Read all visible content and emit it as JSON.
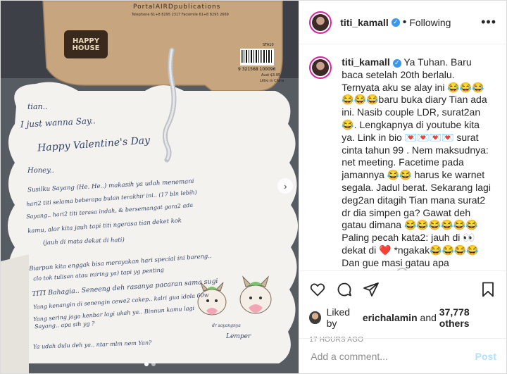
{
  "colors": {
    "accent": "#3897f0",
    "story_ring": "#d6249f",
    "heart": "#ed4956"
  },
  "photo": {
    "publisher": "PortalAIRDpublications",
    "publisher_contact": "Telephone 61+8 8295 2317 Facsimile 61+8 8295 2669",
    "logo": "HAPPY HOUSE",
    "barcode": "9 321568 100096",
    "sku": "STA10",
    "price": "Aust $3.95",
    "origin": "Litho in China",
    "letter_lines": [
      "tian..",
      "I just wanna Say..",
      "Happy Valentine's Day",
      "Honey..",
      "Susilku Sayang (He. He..) makasih ya udah menemani",
      "hari2 titi selama beberapa bulan terakhir ini.. (17 bln lebih)",
      "Sayang.. hari2 titi terasa indah, & bersemangat gara2 ada",
      "kamu, alor kita jauh tapi titi ngerasa tian deket kok",
      "(jauh di mata dekat di hati)",
      "Biarpun kita enggak bisa merayakan hari special ini bareng..",
      "clo tok tulisan atau miring ya) tapi yg penting",
      "TITI Bahagia.. Seneeng deh rasanya pacaran sama sugi",
      "Yang kenangin di senengin cewe2 cakep.. kalri gua idola 60w",
      "Yang sering jaga kenbar lagi ukah ya.. Binnun kamu lagi",
      "Sayang.. apa sih yg ?",
      "Ya udah dulu deh ya.. ntar mlm nem Yan?",
      "Lemper"
    ],
    "sticker_text": "dr sayangnya",
    "page_count": 2,
    "active_page": 1
  },
  "header": {
    "username": "titi_kamall",
    "verified": true,
    "separator": "•",
    "follow_label": "Following",
    "more": "•••"
  },
  "caption": {
    "username": "titi_kamall",
    "text": "Ya Tuhan. Baru baca setelah 20th berlalu. Ternyata aku se alay ini 😂😂😂😂😂😂baru buka diary Tian ada ini. Nasib couple LDR, surat2an😂. Lengkapnya di youtube kita ya. Link in bio 💌💌💌💌 surat cinta tahun 99 . Nem maksudnya: net meeting. Facetime pada jamannya 😂😂 harus ke warnet segala. Jadul berat. Sekarang lagi deg2an ditagih Tian mana surat2 dr dia simpen ga? Gawat deh gatau dimana 😂😂😂😂😂😂 Paling pecah kata2: jauh di 👀 dekat di ❤️ *ngakak😂😂😂😂 Dan gue masi gatau apa maksudnya lemper ya 😂😂😂😂😂 Huruf G nya kenapa kayak donat ya",
    "time": "17h"
  },
  "actions": {
    "like": "heart-icon",
    "comment": "comment-icon",
    "share": "share-icon",
    "save": "bookmark-icon"
  },
  "likes": {
    "prefix": "Liked by",
    "user": "erichalamin",
    "middle": "and",
    "count": "37,778 others"
  },
  "timestamp": "17 HOURS AGO",
  "comment": {
    "placeholder": "Add a comment...",
    "post_label": "Post"
  }
}
